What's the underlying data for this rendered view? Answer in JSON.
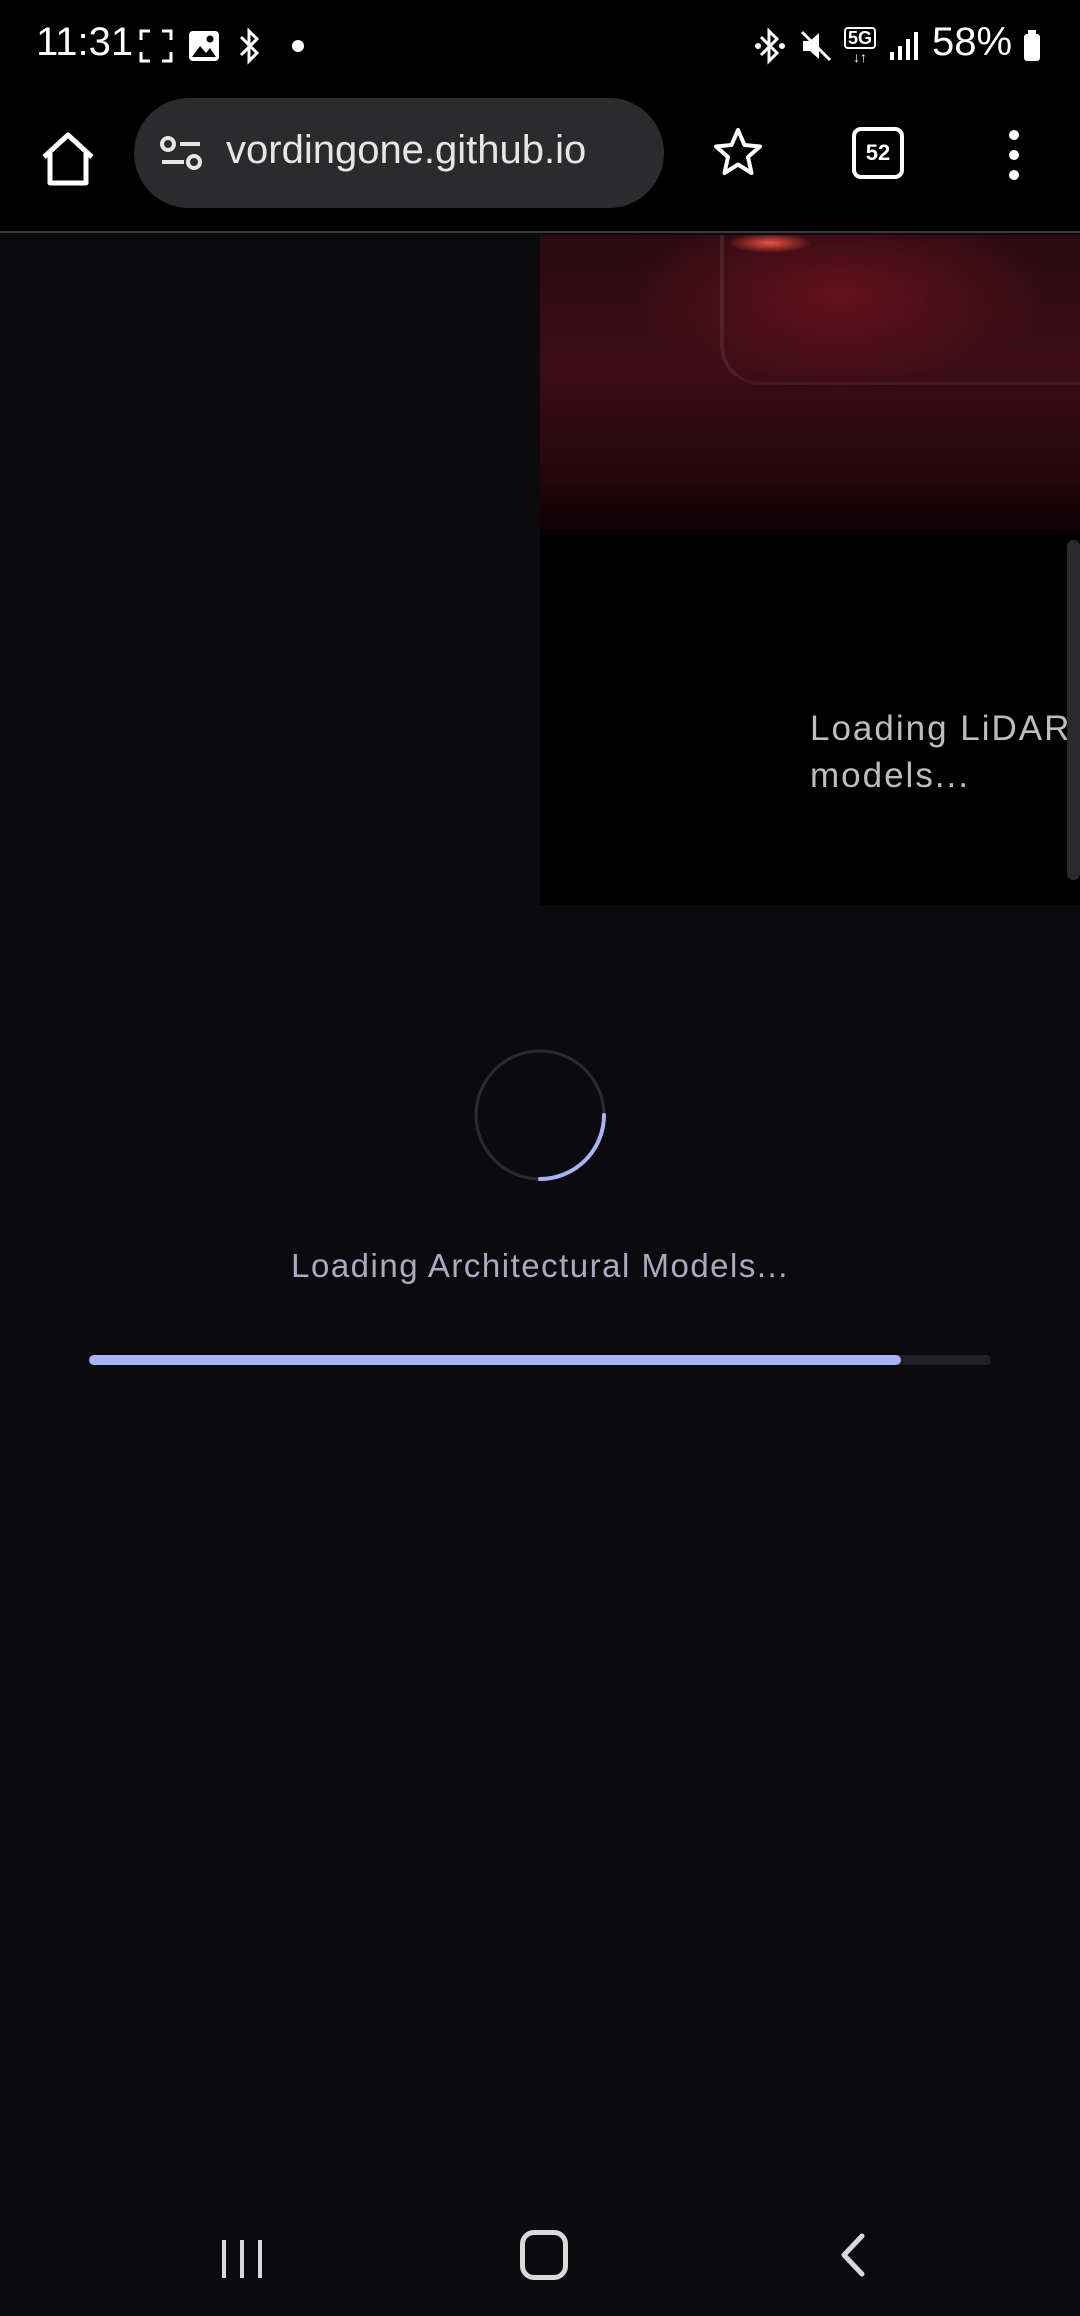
{
  "status_bar": {
    "time": "11:31",
    "battery": "58%",
    "network": "5G",
    "icons": [
      "screenshot-icon",
      "gallery-icon",
      "bluetooth-icon",
      "dot-icon",
      "bluetooth-icon",
      "mute-icon",
      "5g-icon",
      "signal-icon",
      "battery-icon"
    ]
  },
  "browser": {
    "url": "vordingone.github.io",
    "tab_count": "52"
  },
  "page": {
    "lidar_loading": "Loading LiDAR models...",
    "loading_text": "Loading Architectural Models...",
    "progress": 0.9
  },
  "nav_bar": {
    "buttons": [
      "recents",
      "home",
      "back"
    ]
  },
  "colors": {
    "background": "#0b0b0f",
    "accent": "#a8b4f5",
    "progress_track": "#1f1f27"
  }
}
